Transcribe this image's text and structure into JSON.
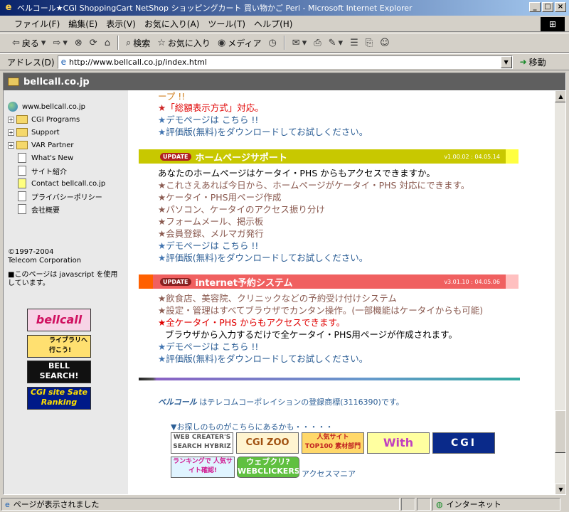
{
  "window": {
    "title": "ベルコール★CGI ShoppingCart NetShop ショッピングカート 買い物かご Perl - Microsoft Internet Explorer",
    "minimize": "_",
    "maximize": "□",
    "close": "×"
  },
  "menu": [
    "ファイル(F)",
    "編集(E)",
    "表示(V)",
    "お気に入り(A)",
    "ツール(T)",
    "ヘルプ(H)"
  ],
  "toolbar": {
    "back": "戻る",
    "search": "検索",
    "favorites": "お気に入り",
    "media": "メディア"
  },
  "address": {
    "label": "アドレス(D)",
    "url": "http://www.bellcall.co.jp/index.html",
    "go": "移動"
  },
  "site": {
    "header": "bellcall.co.jp"
  },
  "tree": [
    {
      "label": "www.bellcall.co.jp",
      "type": "globe"
    },
    {
      "label": "CGI Programs",
      "type": "folder"
    },
    {
      "label": "Support",
      "type": "folder"
    },
    {
      "label": "VAR Partner",
      "type": "folder"
    },
    {
      "label": "What's New",
      "type": "doc"
    },
    {
      "label": "サイト紹介",
      "type": "doc"
    },
    {
      "label": "Contact bellcall.co.jp",
      "type": "note"
    },
    {
      "label": "プライバシーポリシー",
      "type": "doc"
    },
    {
      "label": "会社概要",
      "type": "doc"
    }
  ],
  "sidebar": {
    "copyright": "©1997-2004",
    "company": "Telecom Corporation",
    "js_note": "■このページは javascript を使用しています。",
    "banners": [
      "bellcall",
      "ライブラリへ行こう!",
      "BELL SEARCH!",
      "CGI site Sate Ranking"
    ]
  },
  "content": {
    "top_partial": "ープ !!",
    "top_lines": [
      {
        "text": "「総額表示方式」対応。",
        "style": "red"
      },
      {
        "text": "デモページは こちら !!",
        "style": "blue"
      },
      {
        "text": "評価版(無料)をダウンロードしてお試しください。",
        "style": "blue"
      }
    ],
    "section1": {
      "badge": "UPDATE",
      "title": "ホームページサポート",
      "version": "v1.00.02 : 04.05.14",
      "intro": "あなたのホームページはケータイ・PHS からもアクセスできますか。",
      "lines": [
        {
          "text": "これさえあれば今日から、ホームページがケータイ・PHS 対応にできます。",
          "style": "brown"
        },
        {
          "text": "ケータイ・PHS用ページ作成",
          "style": "brown"
        },
        {
          "text": "パソコン、ケータイのアクセス振り分け",
          "style": "brown"
        },
        {
          "text": "フォームメール、掲示板",
          "style": "brown"
        },
        {
          "text": "会員登録、メルマガ発行",
          "style": "brown"
        },
        {
          "text": "デモページは こちら !!",
          "style": "blue"
        },
        {
          "text": "評価版(無料)をダウンロードしてお試しください。",
          "style": "blue"
        }
      ]
    },
    "section2": {
      "badge": "UPDATE",
      "title": "internet予約システム",
      "version": "v3.01.10 : 04.05.06",
      "lines": [
        {
          "text": "飲食店、美容院、クリニックなどの予約受け付けシステム",
          "style": "brown"
        },
        {
          "text": "設定・管理はすべてブラウザでカンタン操作。(一部機能はケータイからも可能)",
          "style": "brown"
        },
        {
          "text": "全ケータイ・PHS からもアクセスできます。",
          "style": "red"
        },
        {
          "text": "ブラウザから入力するだけで全ケータイ・PHS用ページが作成されます。",
          "style": "plain"
        },
        {
          "text": "デモページは こちら !!",
          "style": "blue"
        },
        {
          "text": "評価版(無料)をダウンロードしてお試しください。",
          "style": "blue"
        }
      ]
    },
    "trademark_brand": "ベルコール",
    "trademark_text": " はテレコムコーポレイションの登録商標(3116390)です。",
    "find_text": "▼お探しのものがこちらにあるかも・・・・・",
    "links": {
      "hybriz": "WEB CREATER'S SEARCH HYBRIZ",
      "cgizoo": "CGI ZOO",
      "top100": "人気サイト TOP100 素材部門",
      "with": "With",
      "cgi": "CGI",
      "ranking": "ランキングで 人気サイト確認!",
      "webclickers": "ウェブクリ? WEBCLICKERS.NET",
      "accessmania": "アクセスマニア"
    }
  },
  "status": {
    "text": "ページが表示されました",
    "zone": "インターネット"
  },
  "colors": {
    "section1_bar": "#c8c800",
    "section2_bar": "#f06060",
    "title_gradient_start": "#0a246a"
  }
}
